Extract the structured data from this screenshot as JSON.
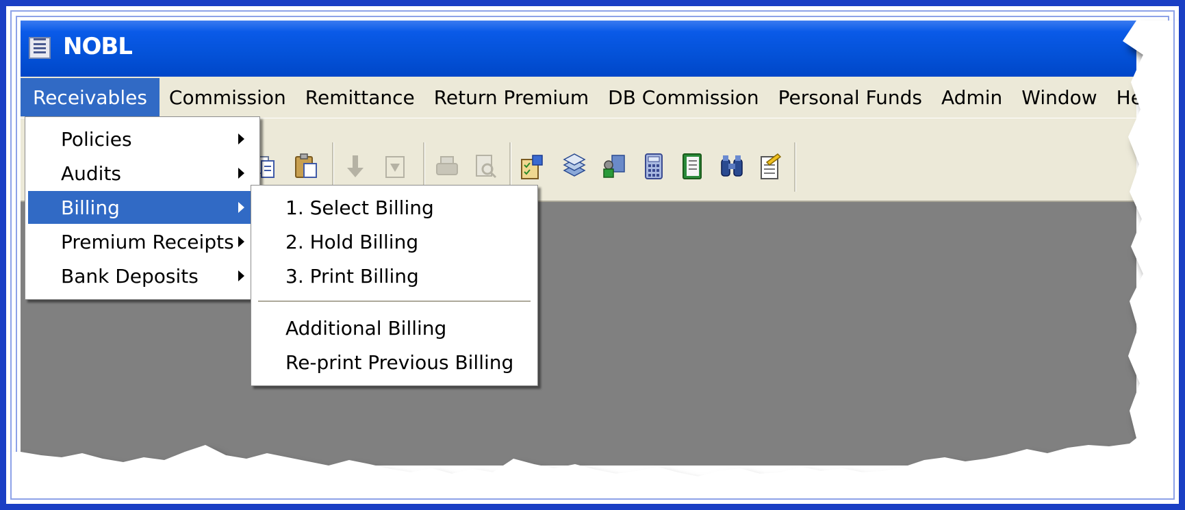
{
  "window": {
    "title": "NOBL"
  },
  "menubar": {
    "items": [
      {
        "label": "Receivables",
        "active": true
      },
      {
        "label": "Commission"
      },
      {
        "label": "Remittance"
      },
      {
        "label": "Return Premium"
      },
      {
        "label": "DB Commission"
      },
      {
        "label": "Personal Funds"
      },
      {
        "label": "Admin"
      },
      {
        "label": "Window"
      },
      {
        "label": "Help"
      }
    ]
  },
  "toolbar": {
    "icons": [
      "copy-icon",
      "paste-icon",
      "arrow-down-icon",
      "import-icon",
      "print-icon",
      "print-preview-icon",
      "checklist-icon",
      "stack-icon",
      "users-icon",
      "calculator-icon",
      "notebook-icon",
      "binoculars-icon",
      "edit-note-icon"
    ]
  },
  "receivables_menu": {
    "items": [
      {
        "label": "Policies",
        "submenu": true
      },
      {
        "label": "Audits",
        "submenu": true
      },
      {
        "label": "Billing",
        "submenu": true,
        "highlighted": true
      },
      {
        "label": "Premium Receipts",
        "submenu": true
      },
      {
        "label": "Bank Deposits",
        "submenu": true
      }
    ]
  },
  "billing_submenu": {
    "items": [
      {
        "label": "1. Select Billing"
      },
      {
        "label": "2. Hold Billing"
      },
      {
        "label": "3. Print Billing"
      },
      {
        "label": "Additional Billing"
      },
      {
        "label": "Re-print Previous Billing"
      }
    ]
  },
  "colors": {
    "frame": "#1a3fc4",
    "title_bar": "#0452d8",
    "highlight": "#316ac5",
    "menubar": "#ece9d8",
    "workspace": "#808080"
  }
}
